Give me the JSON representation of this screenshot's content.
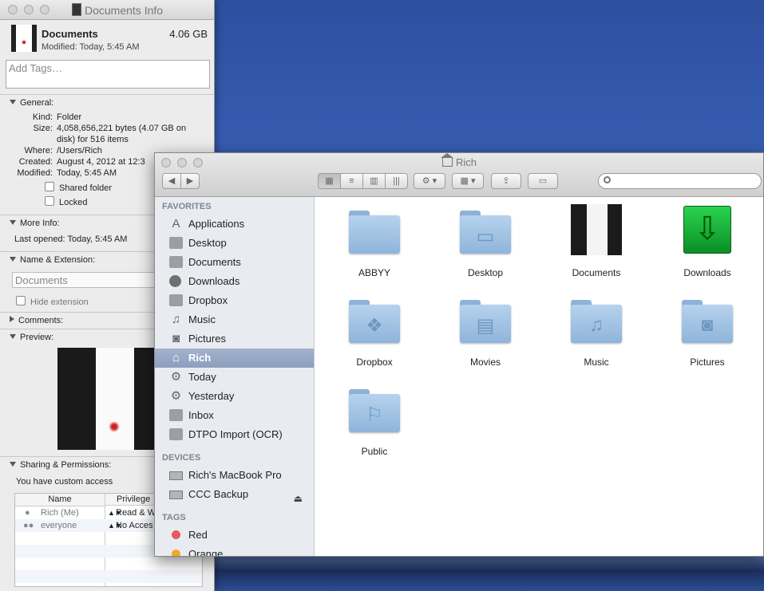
{
  "info": {
    "window_title": "Documents Info",
    "name": "Documents",
    "size": "4.06 GB",
    "modified": "Modified: Today, 5:45 AM",
    "tags_placeholder": "Add Tags…",
    "general": {
      "header": "General:",
      "kind_k": "Kind:",
      "kind_v": "Folder",
      "size_k": "Size:",
      "size_v1": "4,058,656,221 bytes (4.07 GB on",
      "size_v2": "disk) for 516 items",
      "where_k": "Where:",
      "where_v": "/Users/Rich",
      "created_k": "Created:",
      "created_v": "August 4, 2012 at 12:3",
      "modified_k": "Modified:",
      "modified_v": "Today, 5:45 AM",
      "shared": "Shared folder",
      "locked": "Locked"
    },
    "more_info": {
      "header": "More Info:",
      "last_opened": "Last opened: Today, 5:45 AM"
    },
    "name_ext": {
      "header": "Name & Extension:",
      "value": "Documents",
      "hide_ext": "Hide extension"
    },
    "comments": {
      "header": "Comments:"
    },
    "preview": {
      "header": "Preview:"
    },
    "sharing": {
      "header": "Sharing & Permissions:",
      "access": "You have custom access",
      "col_name": "Name",
      "col_priv": "Privilege",
      "rows": [
        {
          "name": "Rich (Me)",
          "priv": "Read & W"
        },
        {
          "name": "everyone",
          "priv": "No Acces"
        }
      ]
    }
  },
  "finder": {
    "title": "Rich",
    "sidebar": {
      "favorites_label": "FAVORITES",
      "favorites": [
        "Applications",
        "Desktop",
        "Documents",
        "Downloads",
        "Dropbox",
        "Music",
        "Pictures",
        "Rich",
        "Today",
        "Yesterday",
        "Inbox",
        "DTPO Import (OCR)"
      ],
      "devices_label": "DEVICES",
      "devices": [
        "Rich's MacBook Pro",
        "CCC Backup"
      ],
      "tags_label": "TAGS",
      "tags": [
        {
          "name": "Red",
          "color": "#e85a5a"
        },
        {
          "name": "Orange",
          "color": "#f5a623"
        }
      ]
    },
    "items": [
      "ABBYY",
      "Desktop",
      "Documents",
      "Downloads",
      "Dropbox",
      "Movies",
      "Music",
      "Pictures",
      "Public"
    ]
  }
}
